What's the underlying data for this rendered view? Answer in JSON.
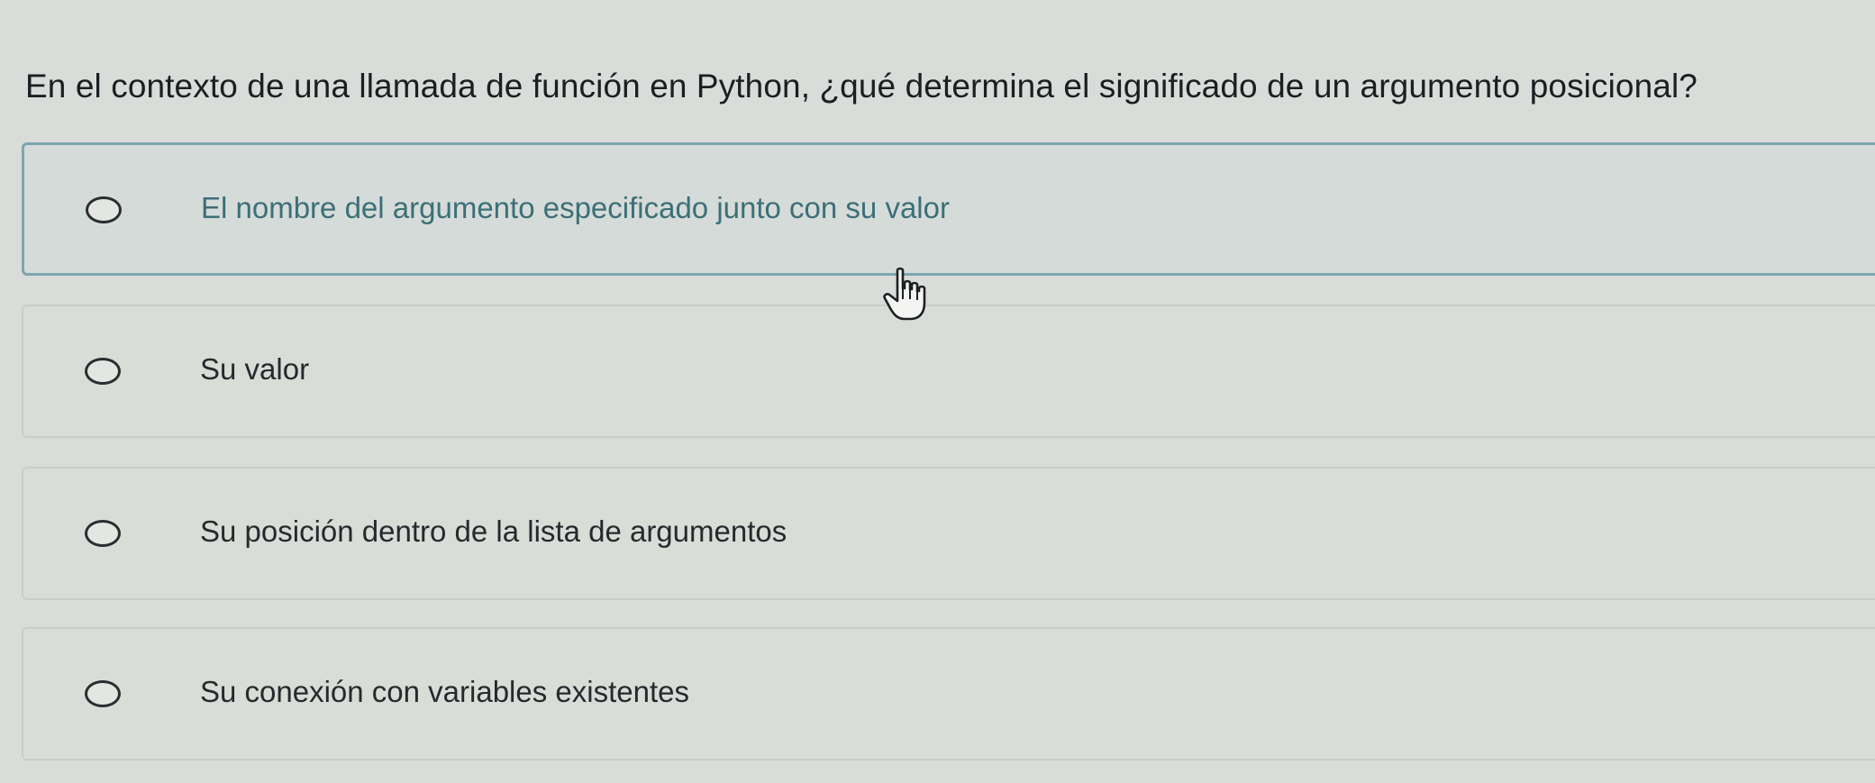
{
  "question": {
    "text": "En el contexto de una llamada de función en Python, ¿qué determina el significado de un argumento posicional?"
  },
  "options": [
    {
      "label": "El nombre del argumento especificado junto con su valor",
      "selected": false,
      "hovered": true
    },
    {
      "label": "Su valor",
      "selected": false,
      "hovered": false
    },
    {
      "label": "Su posición dentro de la lista de argumentos",
      "selected": false,
      "hovered": false
    },
    {
      "label": "Su conexión con variables existentes",
      "selected": false,
      "hovered": false
    }
  ],
  "cursor": {
    "icon": "hand-pointer-icon"
  },
  "colors": {
    "background": "#d9dcd8",
    "hover_border": "#7aa7b0",
    "hover_text": "#3c6f78",
    "text": "#1f2326"
  }
}
